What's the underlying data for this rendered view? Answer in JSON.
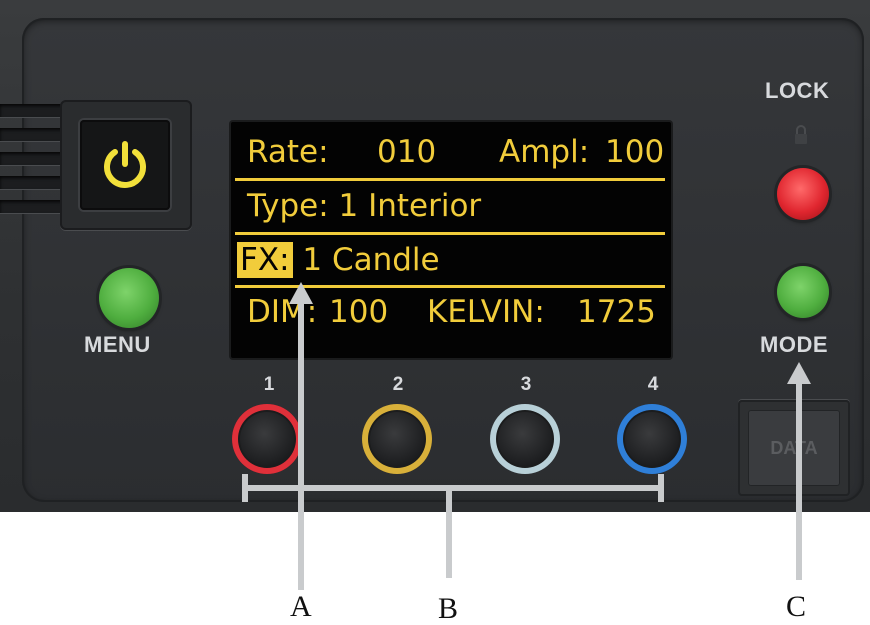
{
  "display": {
    "line1": {
      "rate_label": "Rate:",
      "rate_value": "010",
      "ampl_label": "Ampl:",
      "ampl_value": "100"
    },
    "line2": {
      "text": "Type: 1 Interior"
    },
    "line3": {
      "fx_label": "FX:",
      "fx_value": "1 Candle"
    },
    "line4": {
      "dim_label": "DIM:",
      "dim_value": "100",
      "kelvin_label": "KELVIN:",
      "kelvin_value": "1725"
    },
    "text_color": "#f1cc3b",
    "background_color": "#030303"
  },
  "buttons": {
    "power": {
      "icon": "power-icon",
      "color": "#f2e03a"
    },
    "menu": {
      "label": "MENU",
      "color": "#4fae3f"
    },
    "lock": {
      "label": "LOCK",
      "icon": "lock-icon",
      "color": "#e0262f"
    },
    "mode": {
      "label": "MODE",
      "color": "#4fae3f"
    },
    "data_port": {
      "label": "DATA"
    }
  },
  "soft_keys": [
    {
      "number": "1",
      "ring_color": "#e0303a"
    },
    {
      "number": "2",
      "ring_color": "#d8b03a"
    },
    {
      "number": "3",
      "ring_color": "#b8d0d8"
    },
    {
      "number": "4",
      "ring_color": "#2f7fd8"
    }
  ],
  "callouts": {
    "a": "A",
    "b": "B",
    "c": "C"
  }
}
